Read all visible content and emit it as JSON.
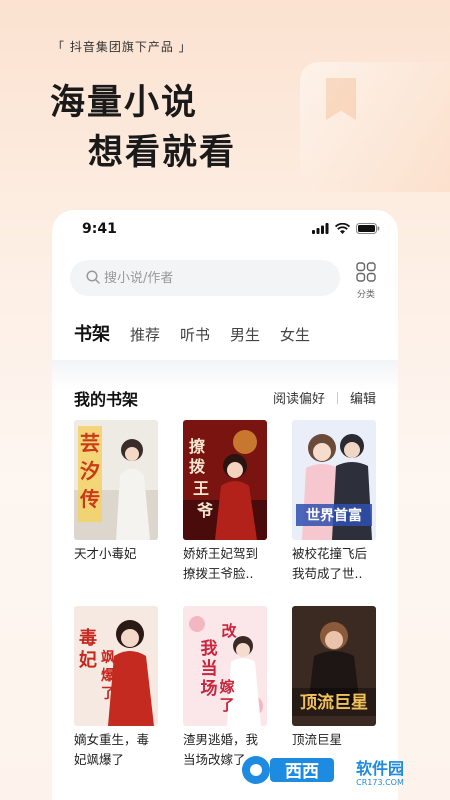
{
  "promo": {
    "tag": "「 抖音集团旗下产品 」",
    "headline_line1": "海量小说",
    "headline_line2": "想看就看"
  },
  "status_bar": {
    "time": "9:41"
  },
  "search": {
    "placeholder": "搜小说/作者"
  },
  "category": {
    "label": "分类",
    "icon": "grid-icon"
  },
  "tabs": [
    {
      "label": "书架",
      "active": true
    },
    {
      "label": "推荐"
    },
    {
      "label": "听书"
    },
    {
      "label": "男生"
    },
    {
      "label": "女生"
    }
  ],
  "shelf": {
    "title": "我的书架",
    "reading_pref": "阅读偏好",
    "edit": "编辑",
    "books": [
      {
        "title_line1": "天才小毒妃",
        "title_line2": "",
        "cover_text": "芸汐传",
        "accent": "#e6c27a"
      },
      {
        "title_line1": "娇娇王妃驾到",
        "title_line2": "撩拨王爷脸..",
        "cover_text": "撩拨王爷",
        "accent": "#9a1c16"
      },
      {
        "title_line1": "被校花撞飞后",
        "title_line2": "我苟成了世..",
        "cover_text": "世界首富",
        "accent": "#8aa6d8"
      },
      {
        "title_line1": "嫡女重生，毒",
        "title_line2": "妃飒爆了",
        "cover_text": "毒妃飒爆了",
        "accent": "#c4281f"
      },
      {
        "title_line1": "渣男逃婚，我",
        "title_line2": "当场改嫁了",
        "cover_text": "我当场改嫁了",
        "accent": "#f1c6cd"
      },
      {
        "title_line1": "顶流巨星",
        "title_line2": "",
        "cover_text": "顶流巨星",
        "accent": "#5a3a2a"
      }
    ]
  },
  "watermark": {
    "brand": "西西软件园",
    "url": "CR173.COM"
  }
}
